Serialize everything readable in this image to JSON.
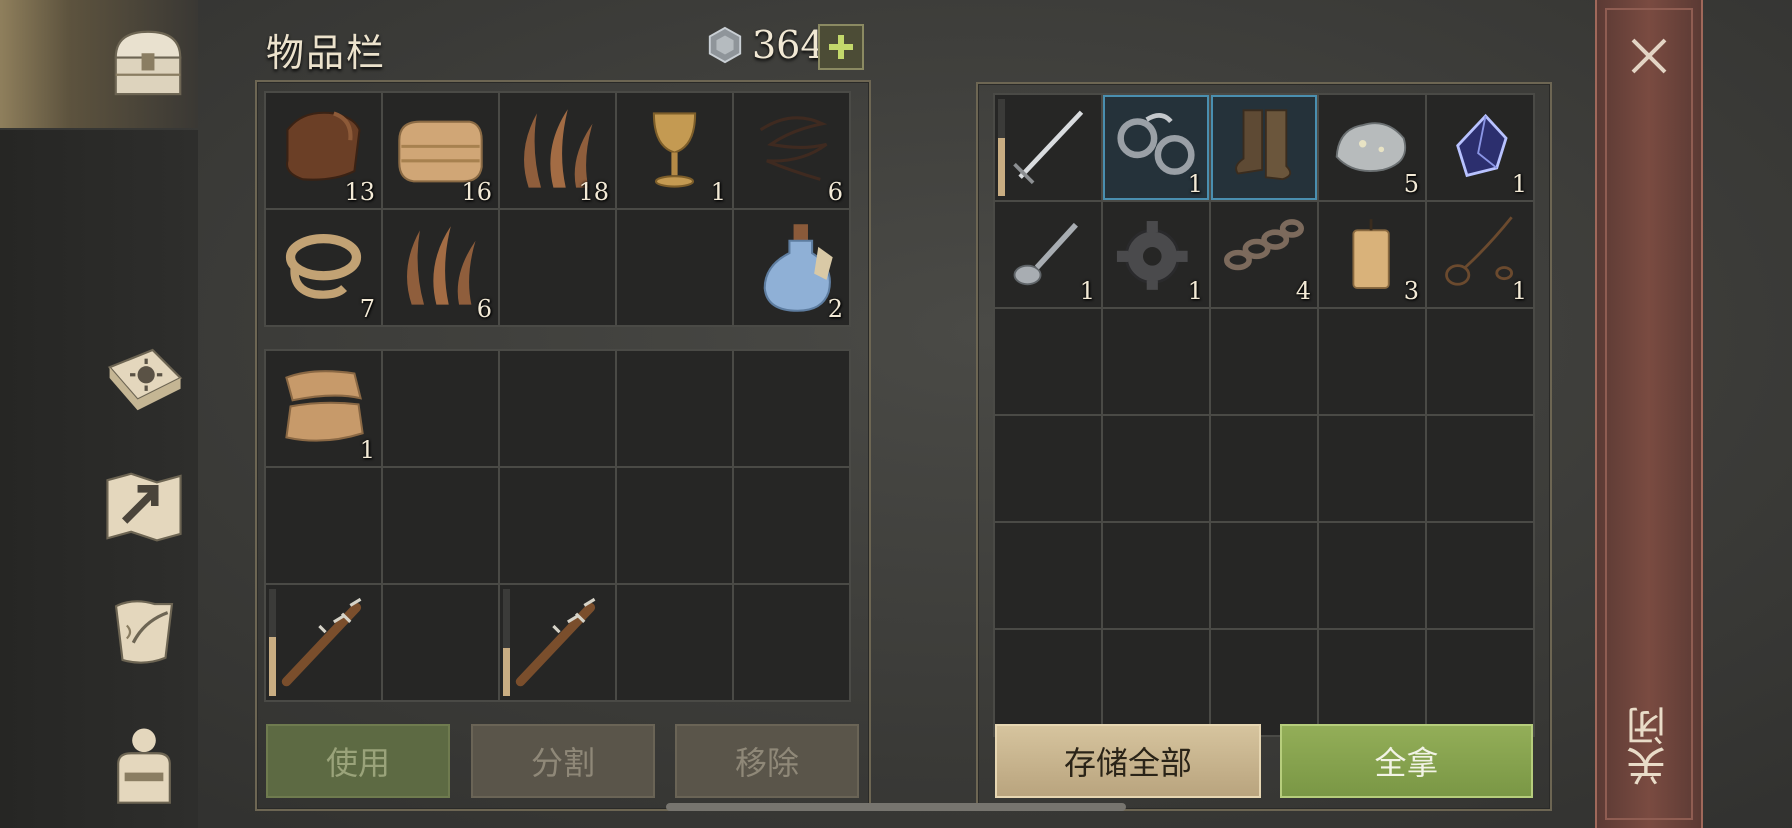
{
  "inventory": {
    "title": "物品栏",
    "currency": {
      "icon": "silver-coin-icon",
      "amount": "364",
      "add_icon": "plus-icon"
    },
    "bag_slots": [
      {
        "icon": "leather-scroll-icon",
        "qty": "13"
      },
      {
        "icon": "folded-cloth-icon",
        "qty": "16"
      },
      {
        "icon": "plant-fiber-icon",
        "qty": "18"
      },
      {
        "icon": "goblet-icon",
        "qty": "1"
      },
      {
        "icon": "wire-icon",
        "qty": "6"
      },
      {
        "icon": "rope-icon",
        "qty": "7"
      },
      {
        "icon": "plant-fiber-icon",
        "qty": "6"
      },
      {
        "icon": "",
        "qty": ""
      },
      {
        "icon": "",
        "qty": ""
      },
      {
        "icon": "potion-bottle-icon",
        "qty": "2"
      }
    ],
    "hotbar_slots": [
      {
        "icon": "cloth-scrap-icon",
        "qty": "1"
      },
      {
        "icon": "",
        "qty": ""
      },
      {
        "icon": "",
        "qty": ""
      },
      {
        "icon": "",
        "qty": ""
      },
      {
        "icon": "",
        "qty": ""
      },
      {
        "icon": "",
        "qty": ""
      },
      {
        "icon": "",
        "qty": ""
      },
      {
        "icon": "",
        "qty": ""
      },
      {
        "icon": "",
        "qty": ""
      },
      {
        "icon": "",
        "qty": ""
      },
      {
        "icon": "spiked-club-icon",
        "qty": "",
        "durability": 0.55
      },
      {
        "icon": "",
        "qty": ""
      },
      {
        "icon": "spiked-club-icon",
        "qty": "",
        "durability": 0.45
      },
      {
        "icon": "",
        "qty": ""
      },
      {
        "icon": "",
        "qty": ""
      }
    ],
    "buttons": {
      "use": "使用",
      "split": "分割",
      "remove": "移除"
    }
  },
  "container": {
    "slots": [
      {
        "icon": "sword-icon",
        "qty": "",
        "durability": 0.6
      },
      {
        "icon": "shackles-icon",
        "qty": "1",
        "selected": true
      },
      {
        "icon": "boots-icon",
        "qty": "",
        "selected": true
      },
      {
        "icon": "silver-ore-icon",
        "qty": "5"
      },
      {
        "icon": "crystal-icon",
        "qty": "1"
      },
      {
        "icon": "spoon-icon",
        "qty": "1"
      },
      {
        "icon": "gear-icon",
        "qty": "1"
      },
      {
        "icon": "chain-icon",
        "qty": "4"
      },
      {
        "icon": "candle-icon",
        "qty": "3"
      },
      {
        "icon": "noose-icon",
        "qty": "1"
      }
    ],
    "empty_rows": 4,
    "buttons": {
      "store_all": "存储全部",
      "take_all": "全拿"
    }
  },
  "close_panel": {
    "label": "关闭",
    "icon": "close-icon"
  },
  "nav": [
    {
      "icon": "chest-icon",
      "active": true
    },
    {
      "icon": "sun-book-icon",
      "active": false
    },
    {
      "icon": "map-icon",
      "active": false
    },
    {
      "icon": "quill-scroll-icon",
      "active": false
    },
    {
      "icon": "character-icon",
      "active": false
    }
  ]
}
